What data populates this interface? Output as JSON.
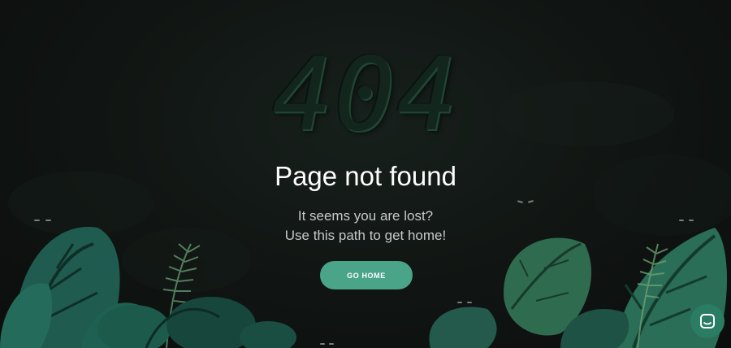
{
  "error": {
    "code": "404",
    "title": "Page not found",
    "subtitle_line1": "It seems you are lost?",
    "subtitle_line2": "Use this path to get home!"
  },
  "actions": {
    "home_label": "GO HOME"
  },
  "widgets": {
    "chat_icon": "chat-bubble-icon"
  },
  "colors": {
    "background": "#101412",
    "accent": "#4aa487",
    "chat_button": "#2a7d63",
    "title_text": "#ffffff",
    "subtitle_text": "#c7cac8"
  }
}
